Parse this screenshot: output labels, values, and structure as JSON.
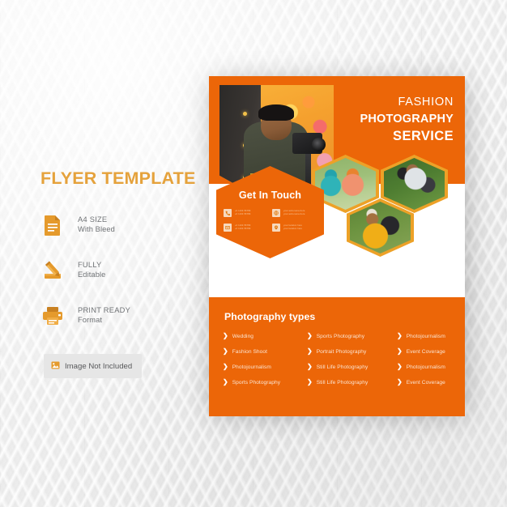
{
  "left_panel": {
    "title": "FLYER TEMPLATE",
    "features": [
      {
        "icon": "document-icon",
        "line1": "A4 SIZE",
        "line2": "With Bleed"
      },
      {
        "icon": "pencil-icon",
        "line1": "FULLY",
        "line2": "Editable"
      },
      {
        "icon": "printer-icon",
        "line1": "PRINT READY",
        "line2": "Format"
      }
    ],
    "badge": {
      "icon": "image-icon",
      "label": "Image Not Included"
    }
  },
  "flyer": {
    "header": {
      "line1": "FASHION",
      "line2": "PHOTOGRAPHY",
      "line3": "SERVICE",
      "hero_photo_alt": "photographer-with-gimbal-camera"
    },
    "get_in_touch": {
      "title": "Get In Touch",
      "items": [
        {
          "icon": "phone-icon",
          "line1": "+0 1234 56789",
          "line2": "+0 1234 56789"
        },
        {
          "icon": "globe-icon",
          "line1": "your.web-name-here",
          "line2": "your.web-name-here"
        },
        {
          "icon": "envelope-icon",
          "line1": "+0 1234 56789",
          "line2": "+0 1234 56789"
        },
        {
          "icon": "location-icon",
          "line1": "your.location  here",
          "line2": "your.location  here"
        }
      ]
    },
    "hex_photos": [
      {
        "name": "hex-photo-kids",
        "alt": "two-children-outdoors"
      },
      {
        "name": "hex-photo-man",
        "alt": "man-photographing-in-forest"
      },
      {
        "name": "hex-photo-yellow",
        "alt": "photographer-in-yellow-jacket"
      }
    ],
    "types": {
      "title": "Photography types",
      "items": [
        "Wedding",
        "Sports Photography",
        "Photojournalism",
        "Fashion Shoot",
        "Portrait Photography",
        "Event Coverage",
        "Photojournalism",
        "Still Life Photography",
        "Photojournalism",
        "Sports Photography",
        "Still Life Photography",
        "Event Coverage"
      ]
    }
  },
  "colors": {
    "orange": "#ec6608",
    "amber": "#e5a23c",
    "hex_border": "#eda127",
    "list_text": "#fbe4d2",
    "muted_text": "#6f7275"
  }
}
